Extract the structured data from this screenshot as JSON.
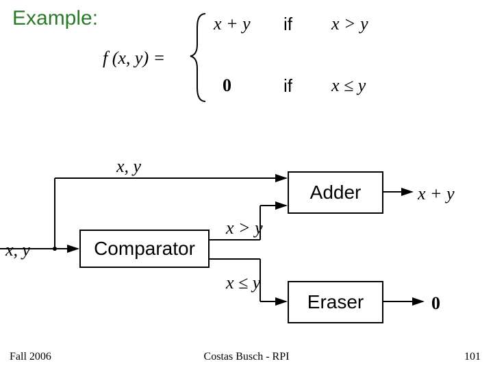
{
  "title": "Example:",
  "func_def": "f (x, y) =",
  "case1_expr": "x + y",
  "case1_if": "if",
  "case1_cond": "x > y",
  "case2_expr": "0",
  "case2_if": "if",
  "case2_cond": "x ≤ y",
  "diagram": {
    "input_top": "x, y",
    "input_left": "x, y",
    "comparator": "Comparator",
    "cond_top": "x > y",
    "cond_bottom": "x ≤ y",
    "adder": "Adder",
    "eraser": "Eraser",
    "out_top": "x + y",
    "out_bottom": "0"
  },
  "footer": {
    "left": "Fall 2006",
    "center": "Costas Busch - RPI",
    "right": "101"
  }
}
